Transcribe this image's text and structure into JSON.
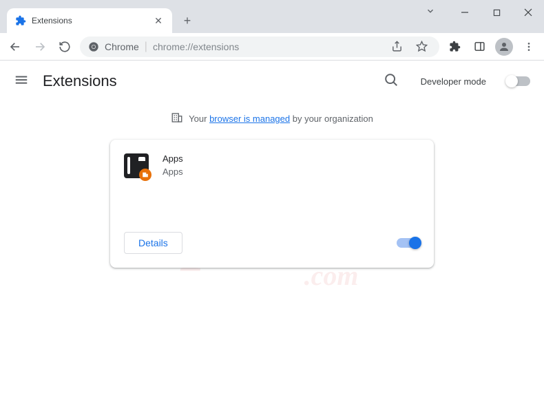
{
  "window": {
    "tab_title": "Extensions"
  },
  "addressbar": {
    "scheme_label": "Chrome",
    "url": "chrome://extensions"
  },
  "header": {
    "title": "Extensions",
    "dev_mode_label": "Developer mode"
  },
  "banner": {
    "prefix": "Your ",
    "link_text": "browser is managed",
    "suffix": " by your organization"
  },
  "extension": {
    "name": "Apps",
    "description": "Apps",
    "details_label": "Details"
  },
  "watermark": {
    "text": "pcrisk",
    "domain": ".com"
  }
}
